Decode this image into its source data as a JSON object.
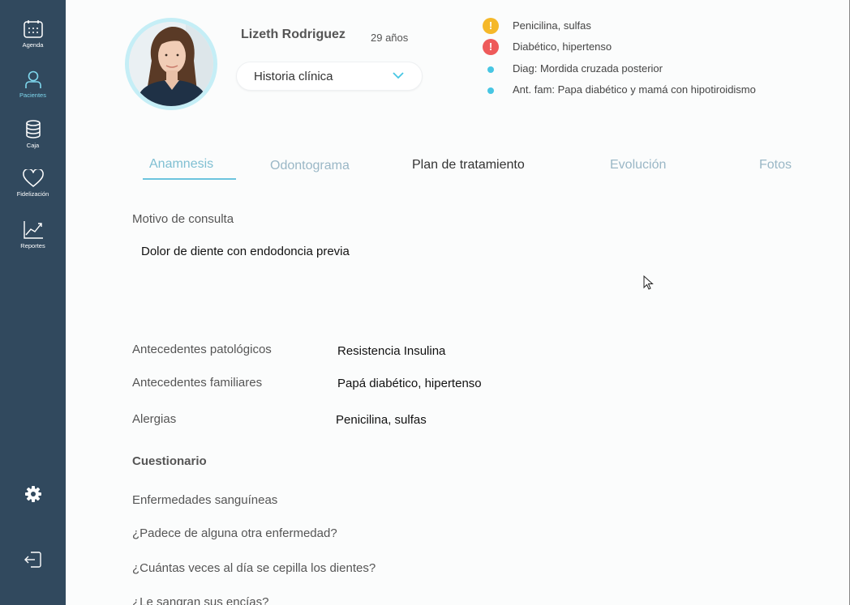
{
  "sidebar": {
    "items": [
      {
        "label": "Agenda",
        "icon": "calendar-icon"
      },
      {
        "label": "Pacientes",
        "icon": "user-icon"
      },
      {
        "label": "Caja",
        "icon": "coins-icon"
      },
      {
        "label": "Fidelización",
        "icon": "heart-icon"
      },
      {
        "label": "Reportes",
        "icon": "chart-icon"
      }
    ],
    "settings_icon": "gear-icon",
    "logout_icon": "logout-icon",
    "background_color": "#31495e",
    "active_color": "#7fd8ee"
  },
  "patient": {
    "name": "Lizeth Rodriguez",
    "age": "29 años",
    "record_selector": "Historia clínica"
  },
  "alerts": [
    {
      "text": "Penicilina, sulfas",
      "type": "warning",
      "color": "#f5b829",
      "symbol": "!"
    },
    {
      "text": "Diabético, hipertenso",
      "type": "danger",
      "color": "#ee5a5a",
      "symbol": "!"
    },
    {
      "text": "Diag: Mordida cruzada posterior",
      "type": "info",
      "color": "#47c6e3"
    },
    {
      "text": "Ant. fam: Papa diabético y mamá con hipotiroidismo",
      "type": "info",
      "color": "#47c6e3"
    }
  ],
  "tabs": [
    {
      "label": "Anamnesis",
      "active": true
    },
    {
      "label": "Odontograma",
      "active": false
    },
    {
      "label": "Plan de tratamiento",
      "active": false
    },
    {
      "label": "Evolución",
      "active": false
    },
    {
      "label": "Fotos",
      "active": false
    }
  ],
  "anamnesis": {
    "motivo_label": "Motivo de consulta",
    "motivo_value": "Dolor de diente con endodoncia previa",
    "fields": [
      {
        "label": "Antecedentes patológicos",
        "value": "Resistencia Insulina"
      },
      {
        "label": "Antecedentes familiares",
        "value": "Papá diabético, hipertenso"
      },
      {
        "label": "Alergias",
        "value": "Penicilina, sulfas"
      }
    ],
    "questionnaire_title": "Cuestionario",
    "questions": [
      "Enfermedades sanguíneas",
      "¿Padece de alguna otra enfermedad?",
      "¿Cuántas veces al día se cepilla los dientes?",
      "¿Le sangran sus encías?"
    ]
  }
}
